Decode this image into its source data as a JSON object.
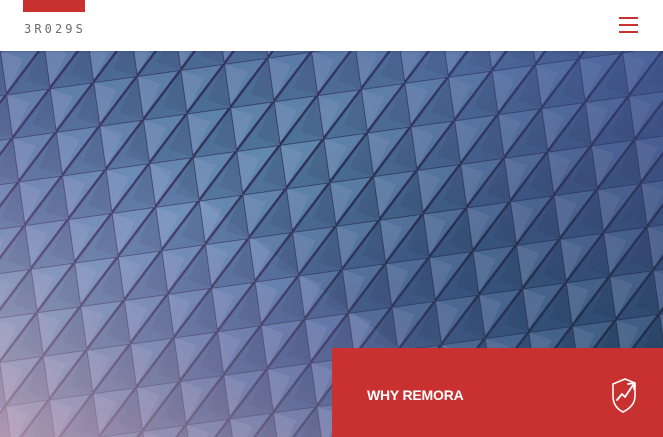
{
  "brand": {
    "logo_text": "3R029S",
    "accent": "#c8312f"
  },
  "header": {
    "menu_icon": "hamburger-menu-icon"
  },
  "hero": {
    "image": "teal-purple-geometric-triangle-facade"
  },
  "cta": {
    "label": "WHY REMORA",
    "icon": "shield-trend-arrow-icon",
    "background": "#c8312f"
  }
}
